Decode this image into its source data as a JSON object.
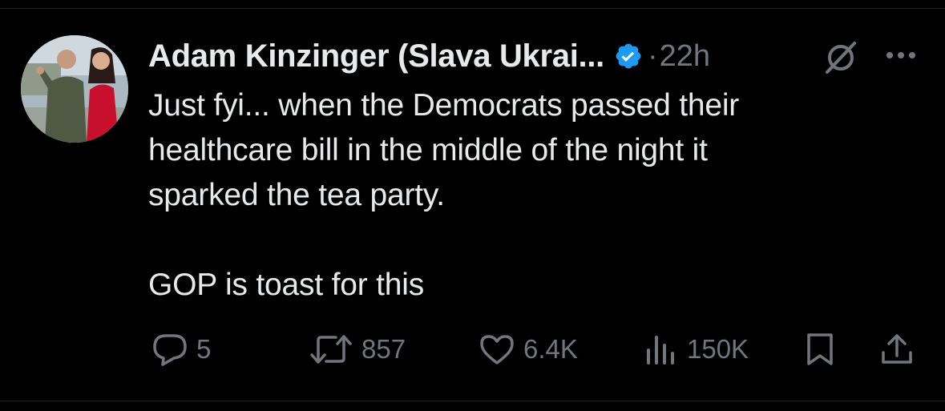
{
  "tweet": {
    "display_name": "Adam Kinzinger (Slava Ukrai...",
    "separator": "·",
    "time": "22h",
    "text": "Just fyi... when the Democrats passed their\nhealthcare bill in the middle of the night it\nsparked the tea party.\n\nGOP is toast for this"
  },
  "actions": {
    "replies": "5",
    "reposts": "857",
    "likes": "6.4K",
    "views": "150K"
  },
  "icons": {
    "verified": "verified-badge-icon",
    "grok": "grok-icon",
    "more": "more-icon",
    "reply": "reply-icon",
    "repost": "repost-icon",
    "like": "heart-icon",
    "views": "views-icon",
    "bookmark": "bookmark-icon",
    "share": "share-icon"
  },
  "colors": {
    "background": "#000000",
    "primary_text": "#e7e9ea",
    "secondary_text": "#71767b",
    "verified": "#1d9bf0"
  }
}
